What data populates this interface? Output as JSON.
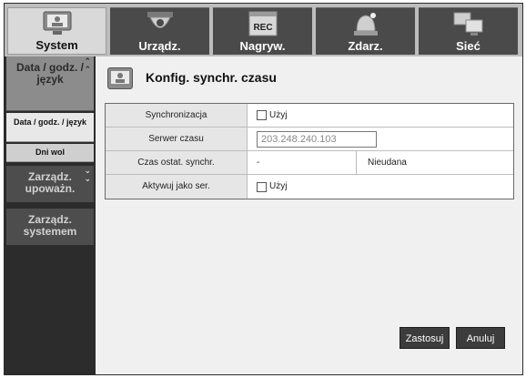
{
  "tabs": [
    {
      "label": "System",
      "icon": "monitor-icon",
      "active": true
    },
    {
      "label": "Urządz.",
      "icon": "camera-icon",
      "active": false
    },
    {
      "label": "Nagryw.",
      "icon": "rec-icon",
      "active": false
    },
    {
      "label": "Zdarz.",
      "icon": "alarm-icon",
      "active": false
    },
    {
      "label": "Sieć",
      "icon": "network-icon",
      "active": false
    }
  ],
  "sidebar": {
    "group1": "Data / godz. / język",
    "sub1": "Data / godz. / język",
    "sub2": "Dni wol",
    "group2": "Zarządz. upoważn.",
    "group3": "Zarządz. systemem"
  },
  "page_title": "Konfig. synchr. czasu",
  "form": {
    "sync_label": "Synchronizacja",
    "sync_option": "Użyj",
    "server_label": "Serwer czasu",
    "server_value": "203.248.240.103",
    "last_sync_label": "Czas ostat. synchr.",
    "last_sync_value": "-",
    "last_sync_status": "Nieudana",
    "activate_label": "Aktywuj jako ser.",
    "activate_option": "Użyj"
  },
  "buttons": {
    "apply": "Zastosuj",
    "cancel": "Anuluj"
  }
}
